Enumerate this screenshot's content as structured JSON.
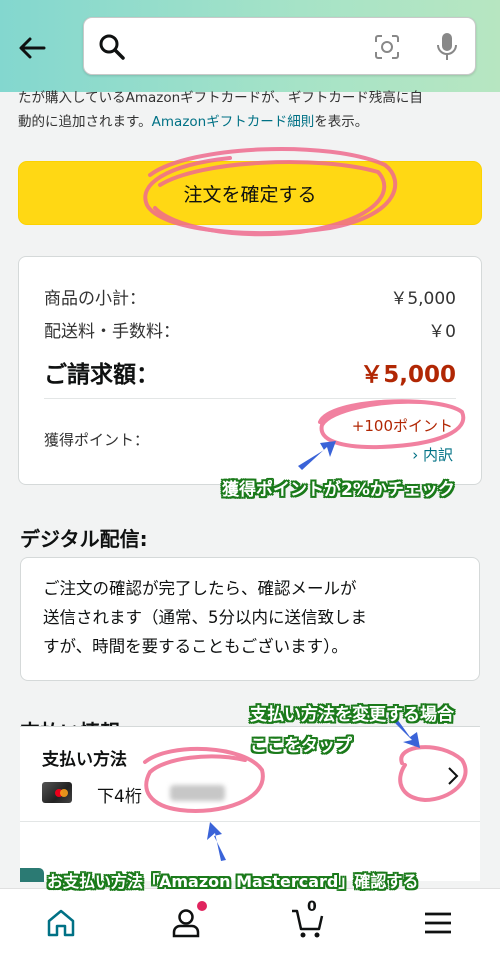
{
  "header": {
    "search": {
      "value": "",
      "placeholder": ""
    }
  },
  "notice": {
    "line1": "たが購入しているAmazonギフトカードが、ギフトカード残高に自",
    "line2_prefix": "動的に追加されます。",
    "link": "Amazonギフトカード細則",
    "line2_suffix": "を表示。"
  },
  "place_order": {
    "label": "注文を確定する"
  },
  "summary": {
    "subtotal_label": "商品の小計：",
    "subtotal_value": "￥5,000",
    "shipping_label": "配送料・手数料：",
    "shipping_value": "￥0",
    "total_label": "ご請求額：",
    "total_value": "￥5,000",
    "points_label": "獲得ポイント：",
    "points_value": "+100ポイント",
    "breakdown_link": "› 内訳"
  },
  "digital": {
    "title": "デジタル配信:",
    "line1": "ご注文の確認が完了したら、確認メールが",
    "line2": "送信されます（通常、5分以内に送信致しま",
    "line3": "すが、時間を要することもございます）。"
  },
  "payment": {
    "title": "支払い情報",
    "method_label": "支払い方法",
    "last4_label": "下4桁"
  },
  "bottom_nav": {
    "cart_count": "0",
    "items": [
      "home-icon",
      "account-icon",
      "cart-icon",
      "menu-icon"
    ]
  },
  "annotations": {
    "points_check": "獲得ポイントが2%かチェック",
    "change_line1": "支払い方法を変更する場合",
    "change_line2": "ここをタップ",
    "confirm_method": "お支払い方法「Amazon Mastercard」確認する"
  },
  "colors": {
    "accent_yellow": "#ffd814",
    "price_red": "#b12704",
    "link_teal": "#007185",
    "annotation_green": "#1a7a1a",
    "highlight_pink": "#ef6b8f",
    "arrow_blue": "#3a63d8"
  }
}
